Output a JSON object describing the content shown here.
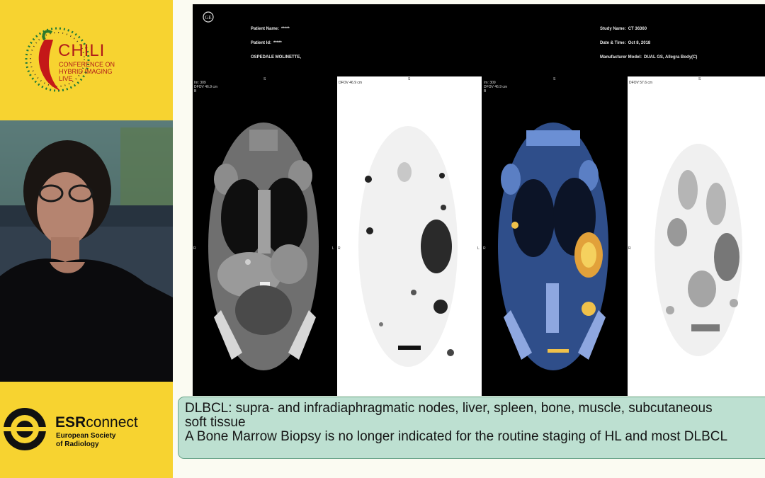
{
  "conference": {
    "name": "CHILI",
    "subtitle_lines": [
      "CONFERENCE ON",
      "HYBRID IMAGING",
      "LIVE"
    ],
    "brand_color": "#b01a1a"
  },
  "esr": {
    "name_bold": "ESR",
    "name_regular": "connect",
    "tagline_lines": [
      "European Society",
      "of Radiology"
    ]
  },
  "scanner_header": {
    "patient_name_label": "Patient Name:",
    "patient_name_value": "*****",
    "patient_id_label": "Patient Id:",
    "patient_id_value": "*****",
    "institution": "OSPEDALE MOLINETTE,",
    "study_name_label": "Study Name:",
    "study_name_value": "CT 36360",
    "date_time_label": "Date & Time:",
    "date_time_value": "Oct 8, 2018",
    "manufacturer_label": "Manufacturer Model:",
    "manufacturer_value": "DUAL GS, Allegra Body(C)"
  },
  "panels": {
    "ct": {
      "line1": "Im: 309",
      "line2": "DFOV 46.9 cm",
      "line3": "B",
      "top": "S",
      "left": "R",
      "right": "L"
    },
    "pet": {
      "line1": "DFOV 46.9 cm",
      "top": "S",
      "left": "R",
      "right": "L"
    },
    "fused": {
      "line1": "Im: 309",
      "line2": "DFOV 46.9 cm",
      "line3": "B",
      "top": "S",
      "left": "R",
      "right": "L"
    },
    "mip": {
      "line1": "DFOV 57.6 cm",
      "top": "S",
      "left": "R"
    }
  },
  "caption": {
    "line1": "DLBCL: supra- and infradiaphragmatic nodes, liver, spleen, bone, muscle, subcutaneous",
    "line2": "soft tissue",
    "line3": "A Bone Marrow Biopsy is no longer indicated for the routine staging of HL and most DLBCL"
  }
}
